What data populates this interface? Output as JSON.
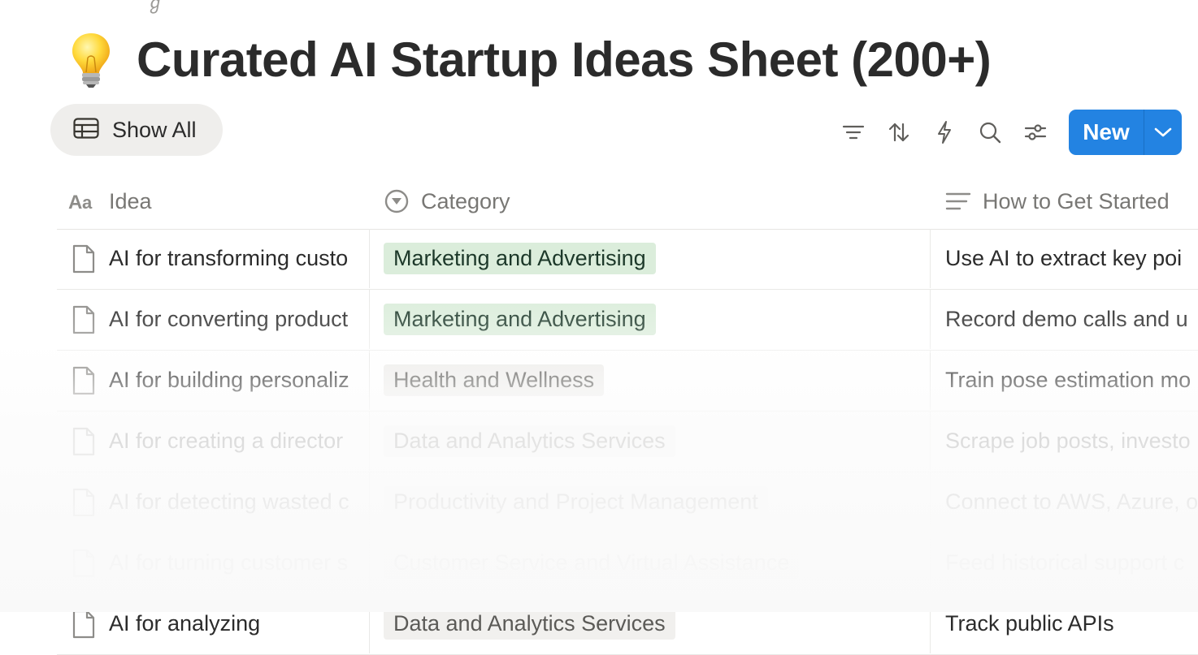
{
  "breadcrumb_fragment": "ℊ",
  "page": {
    "icon": "lightbulb-icon",
    "title": "Curated AI Startup Ideas Sheet (200+)"
  },
  "view": {
    "label": "Show All",
    "icon": "table-icon"
  },
  "toolbar": {
    "icons": [
      "filter-icon",
      "sort-icon",
      "automation-bolt-icon",
      "search-icon",
      "settings-sliders-icon"
    ],
    "new_label": "New",
    "accent": "#2383e2"
  },
  "columns": [
    {
      "label": "Idea",
      "icon": "text-property-icon"
    },
    {
      "label": "Category",
      "icon": "select-property-icon"
    },
    {
      "label": "How to Get Started",
      "icon": "text-lines-icon"
    }
  ],
  "rows": [
    {
      "idea": "AI for transforming custo",
      "category": "Marketing and Advertising",
      "tag_bg": "#dbeddb",
      "tag_fg": "#1c3829",
      "how": "Use AI to extract key poi"
    },
    {
      "idea": "AI for converting product",
      "category": "Marketing and Advertising",
      "tag_bg": "#dbeddb",
      "tag_fg": "#1c3829",
      "how": "Record demo calls and u"
    },
    {
      "idea": "AI for building personaliz",
      "category": "Health and Wellness",
      "tag_bg": "#efeeec",
      "tag_fg": "#5b5a57",
      "how": "Train pose estimation mo"
    },
    {
      "idea": "AI for creating a director",
      "category": "Data and Analytics Services",
      "tag_bg": "#f1f0ee",
      "tag_fg": "#5b5a57",
      "how": "Scrape job posts, investo"
    },
    {
      "idea": "AI for detecting wasted c",
      "category": "Productivity and Project Management",
      "tag_bg": "#f1f0ee",
      "tag_fg": "#5b5a57",
      "how": "Connect to AWS, Azure, o"
    },
    {
      "idea": "AI for turning customer s",
      "category": "Customer Service and Virtual Assistance",
      "tag_bg": "#f1f0ee",
      "tag_fg": "#5b5a57",
      "how": "Feed historical support c"
    },
    {
      "idea": "AI for analyzing",
      "category": "Data and Analytics Services",
      "tag_bg": "#f1f0ee",
      "tag_fg": "#5b5a57",
      "how": "Track public APIs"
    }
  ]
}
